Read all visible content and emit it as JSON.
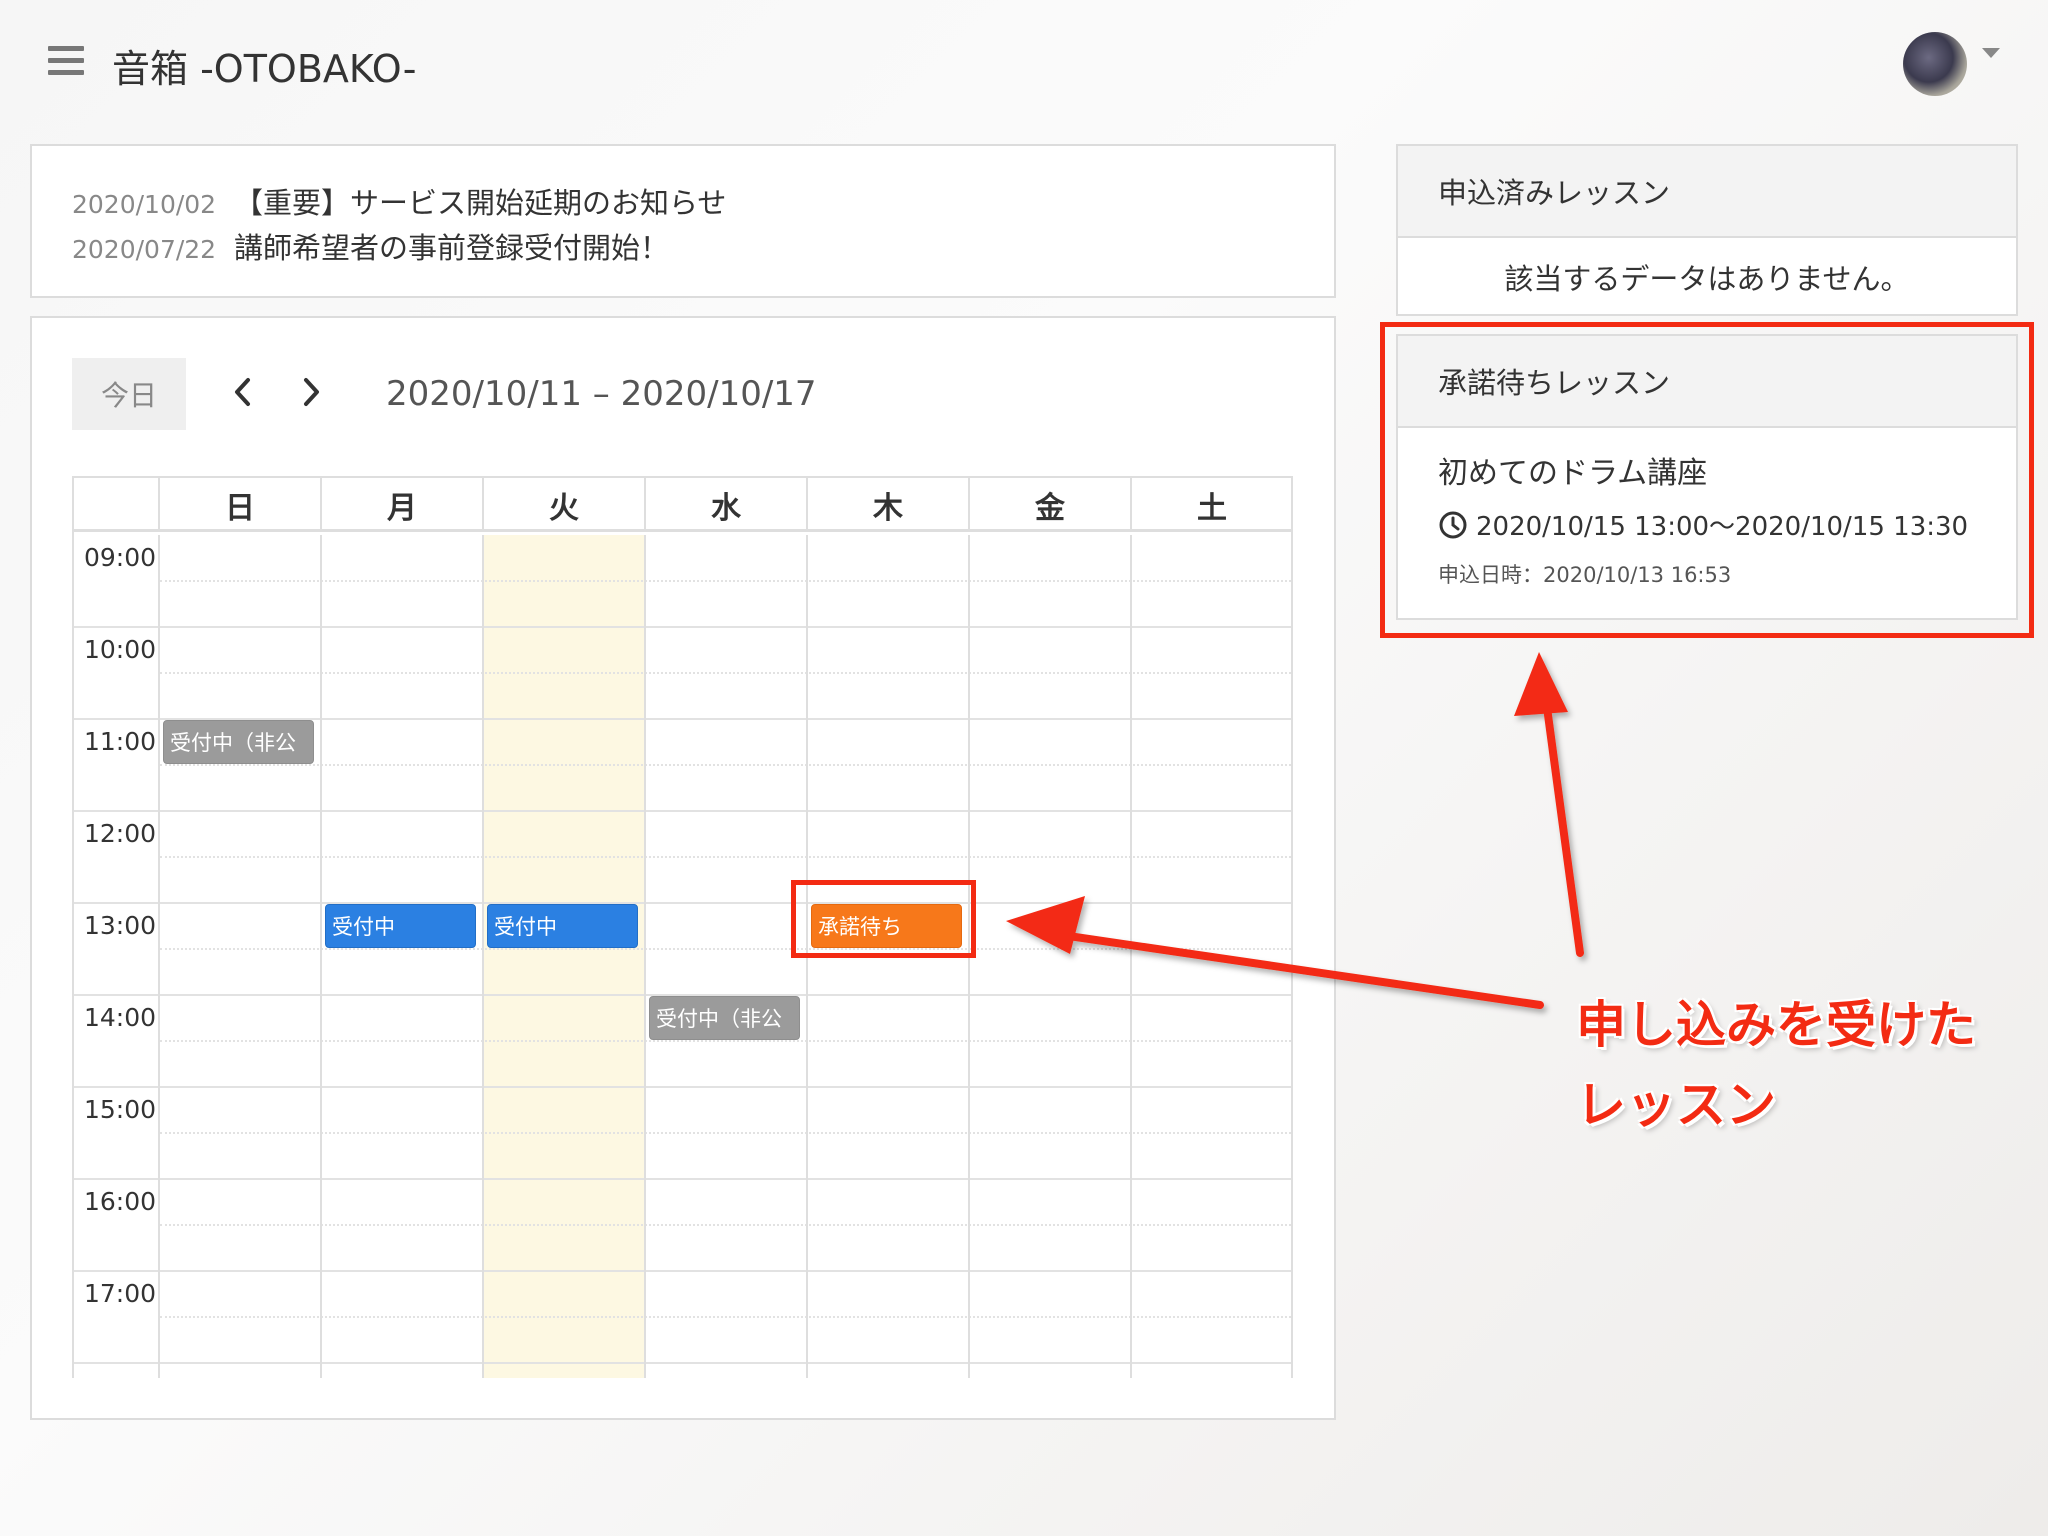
{
  "header": {
    "app_title": "音箱 -OTOBAKO-"
  },
  "news": [
    {
      "date": "2020/10/02",
      "title": "【重要】サービス開始延期のお知らせ"
    },
    {
      "date": "2020/07/22",
      "title": "講師希望者の事前登録受付開始！"
    }
  ],
  "calendar": {
    "today_label": "今日",
    "range": "2020/10/11 – 2020/10/17",
    "days": [
      "日",
      "月",
      "火",
      "水",
      "木",
      "金",
      "土"
    ],
    "times": [
      "09:00",
      "10:00",
      "11:00",
      "12:00",
      "13:00",
      "14:00",
      "15:00",
      "16:00",
      "17:00"
    ],
    "events": [
      {
        "label": "受付中（非公",
        "status": "gray"
      },
      {
        "label": "受付中",
        "status": "blue"
      },
      {
        "label": "受付中",
        "status": "blue"
      },
      {
        "label": "受付中（非公",
        "status": "gray"
      },
      {
        "label": "承諾待ち",
        "status": "orange"
      }
    ]
  },
  "applied_panel": {
    "title": "申込済みレッスン",
    "empty_text": "該当するデータはありません。"
  },
  "pending_panel": {
    "title": "承諾待ちレッスン",
    "lesson_name": "初めてのドラム講座",
    "lesson_time": "2020/10/15 13:00〜2020/10/15 13:30",
    "applied_at": "申込日時：2020/10/13 16:53"
  },
  "annotation": {
    "line1": "申し込みを受けた",
    "line2": "レッスン"
  },
  "colors": {
    "accent_blue": "#2b80e2",
    "pending_orange": "#f7781a",
    "inactive_gray": "#9b9b9b",
    "today_highlight": "#fdf8e2",
    "annotation_red": "#f32b13"
  }
}
